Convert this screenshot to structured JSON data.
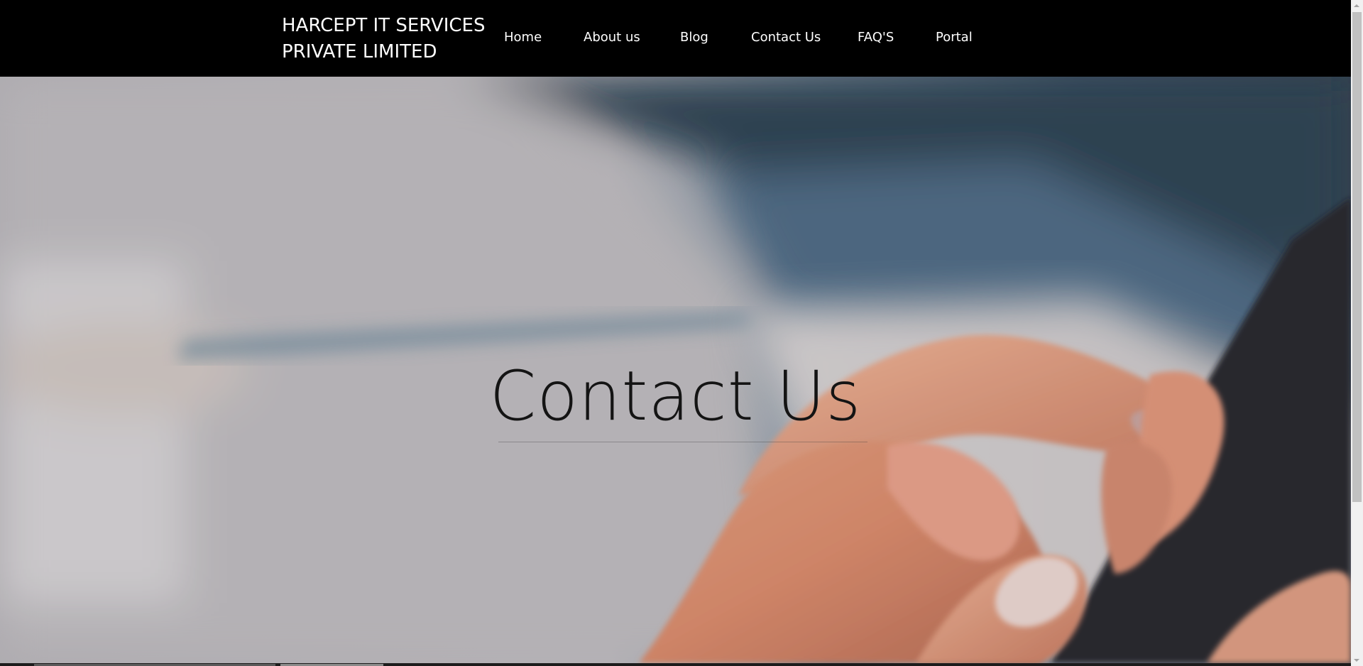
{
  "brand": {
    "line1": "HARCEPT IT SERVICES",
    "line2": "PRIVATE LIMITED"
  },
  "nav": {
    "items": [
      {
        "label": "Home"
      },
      {
        "label": "About us"
      },
      {
        "label": "Blog"
      },
      {
        "label": "Contact Us"
      },
      {
        "label": "FAQ'S"
      },
      {
        "label": "Portal"
      }
    ]
  },
  "hero": {
    "title": "Contact Us"
  },
  "colors": {
    "navbar_bg": "#000000",
    "nav_text": "#ffffff",
    "title_text": "#141414"
  }
}
